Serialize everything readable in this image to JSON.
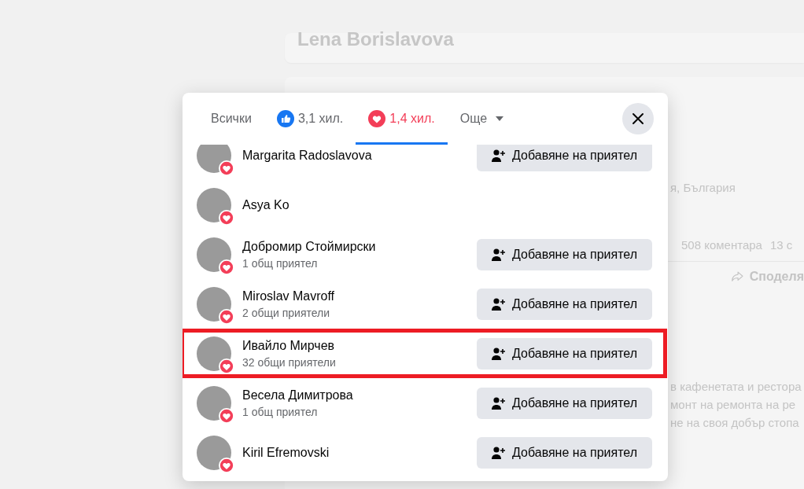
{
  "background": {
    "profile_name": "Lena Borislavova",
    "location": "я, България",
    "comments": "508 коментара",
    "shares": "13 с",
    "share_action": "Споделя",
    "post_lines": [
      "в кафенетата и рестора",
      "монт на ремонта на ре",
      "не на своя добър стопа"
    ]
  },
  "reactions_dialog": {
    "tabs": [
      {
        "kind": "all",
        "label": "Всички",
        "selected": false
      },
      {
        "kind": "like",
        "label": "3,1 хил.",
        "selected": false
      },
      {
        "kind": "love",
        "label": "1,4 хил.",
        "selected": true
      },
      {
        "kind": "more",
        "label": "Още",
        "selected": false
      }
    ],
    "people": [
      {
        "name": "Margarita Radoslavova",
        "button": "Добавяне на приятел",
        "highlighted": false
      },
      {
        "name": "Asya Ko",
        "highlighted": false
      },
      {
        "name": "Добромир Стоймирски",
        "mutual": "1 общ приятел",
        "button": "Добавяне на приятел",
        "highlighted": false
      },
      {
        "name": "Miroslav Mavroff",
        "mutual": "2 общи приятели",
        "button": "Добавяне на приятел",
        "highlighted": false
      },
      {
        "name": "Ивайло Мирчев",
        "mutual": "32 общи приятели",
        "button": "Добавяне на приятел",
        "highlighted": true
      },
      {
        "name": "Весела Димитрова",
        "mutual": "1 общ приятел",
        "button": "Добавяне на приятел",
        "highlighted": false
      },
      {
        "name": "Kiril Efremovski",
        "button": "Добавяне на приятел",
        "highlighted": false
      }
    ]
  }
}
